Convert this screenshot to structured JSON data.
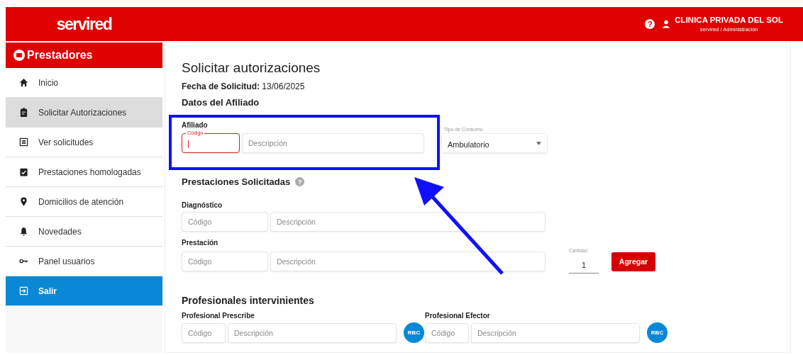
{
  "header": {
    "logo": "servired",
    "help_icon": "?",
    "user": "CLINICA PRIVADA DEL SOL",
    "role": "servired / Administración"
  },
  "sidebar": {
    "title": "Prestadores",
    "items": [
      {
        "label": "Inicio",
        "kind": "home",
        "selected": false
      },
      {
        "label": "Solicitar Autorizaciones",
        "kind": "clipboard",
        "selected": true
      },
      {
        "label": "Ver solicitudes",
        "kind": "list",
        "selected": false
      },
      {
        "label": "Prestaciones homologadas",
        "kind": "check",
        "selected": false
      },
      {
        "label": "Domicilios de atención",
        "kind": "pin",
        "selected": false
      },
      {
        "label": "Novedades",
        "kind": "bell",
        "selected": false
      },
      {
        "label": "Panel usuarios",
        "kind": "key",
        "selected": false
      },
      {
        "label": "Salir",
        "kind": "exit",
        "selected": false
      }
    ]
  },
  "main": {
    "title": "Solicitar autorizaciones",
    "date_label": "Fecha de Solicitud:",
    "date": "13/06/2025",
    "afiliado_section": "Datos del Afiliado",
    "afiliado_label": "Afiliado",
    "afiliado_code": {
      "label": "Código",
      "focused": true
    },
    "afiliado_desc": {
      "placeholder": "Descripción"
    },
    "tipo_consumo": {
      "label": "Tipo de Consumo",
      "value": "Ambulatorio"
    },
    "prestaciones_section": "Prestaciones Solicitadas",
    "prestaciones_help": "?",
    "diagnostico": {
      "label": "Diagnóstico",
      "code_placeholder": "Código",
      "desc_placeholder": "Descripción"
    },
    "prestacion": {
      "label": "Prestación",
      "code_placeholder": "Código",
      "desc_placeholder": "Descripción"
    },
    "cantidad": {
      "label": "Cantidad",
      "value": "1"
    },
    "add_button": "Agregar",
    "profesionales_section": "Profesionales intervinientes",
    "profesionales": [
      {
        "label": "Profesional Prescribe",
        "code_placeholder": "Código",
        "desc_placeholder": "Descripción",
        "button": "RBC"
      },
      {
        "label": "Profesional Efector",
        "code_placeholder": "Código",
        "desc_placeholder": "Descripción",
        "button": "RBC"
      }
    ]
  }
}
